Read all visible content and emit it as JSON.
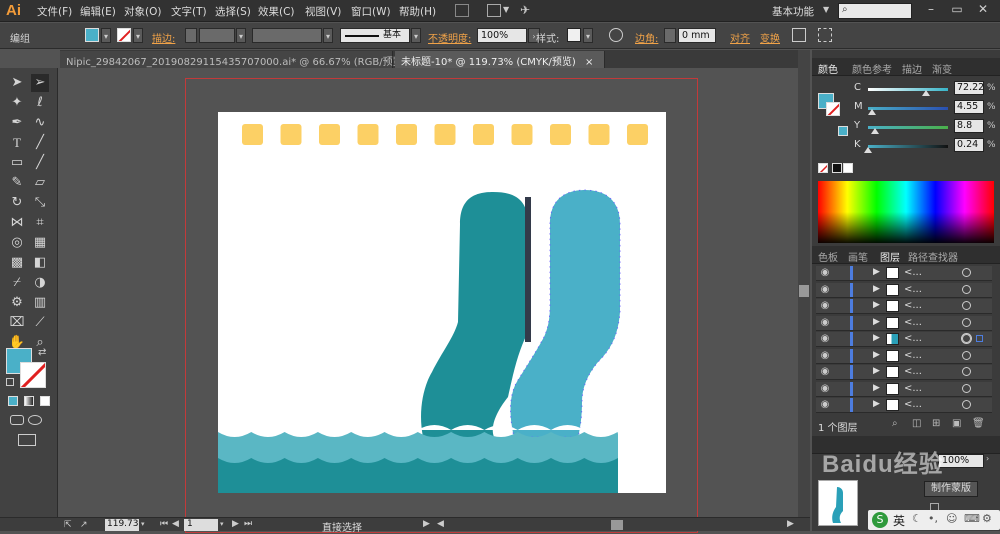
{
  "app": {
    "logo": "Ai",
    "workspace": "基本功能"
  },
  "menu": [
    "文件(F)",
    "编辑(E)",
    "对象(O)",
    "文字(T)",
    "选择(S)",
    "效果(C)",
    "视图(V)",
    "窗口(W)",
    "帮助(H)"
  ],
  "control_bar": {
    "selection_label": "编组",
    "stroke_label": "描边:",
    "stroke_style": "基本",
    "opacity_label": "不透明度:",
    "opacity_value": "100%",
    "style_label": "样式:",
    "corner_label": "边角:",
    "corner_value": "0 mm",
    "align_label": "对齐",
    "transform_label": "变换"
  },
  "tabs": [
    {
      "label": "Nipic_29842067_20190829115435707000.ai* @ 66.67% (RGB/预览)",
      "active": false
    },
    {
      "label": "未标题-10* @ 119.73% (CMYK/预览)",
      "active": true
    }
  ],
  "status_bar": {
    "zoom": "119.73",
    "page": "1",
    "tool": "直接选择"
  },
  "color_panel": {
    "tabs": [
      "颜色",
      "颜色参考",
      "描边",
      "渐变"
    ],
    "sliders": [
      {
        "channel": "C",
        "value": "72.22",
        "fraction": 0.72,
        "color": "#38b4c8"
      },
      {
        "channel": "M",
        "value": "4.55",
        "fraction": 0.05,
        "color": "#d34a9a"
      },
      {
        "channel": "Y",
        "value": "8.8",
        "fraction": 0.09,
        "color": "#d7d24c"
      },
      {
        "channel": "K",
        "value": "0.24",
        "fraction": 0.0,
        "color": "#222222"
      }
    ],
    "pct": "%",
    "fill_color": "#4ab0c8"
  },
  "layers_panel": {
    "tabs": [
      "色板",
      "画笔",
      "图层",
      "路径查找器"
    ],
    "rows": [
      {
        "name": "<...",
        "selected": false
      },
      {
        "name": "<...",
        "selected": false
      },
      {
        "name": "<...",
        "selected": false
      },
      {
        "name": "<...",
        "selected": false
      },
      {
        "name": "<...",
        "selected": true
      },
      {
        "name": "<...",
        "selected": false
      },
      {
        "name": "<...",
        "selected": false
      },
      {
        "name": "<...",
        "selected": false
      },
      {
        "name": "<...",
        "selected": false
      }
    ],
    "footer": "1 个图层"
  },
  "bottom_panel": {
    "opacity_value": "100%",
    "make_mask": "制作蒙版"
  },
  "artwork": {
    "square_color": "#fcd065",
    "dark_teal": "#1e8f97",
    "light_teal": "#4ab0c8",
    "wave_color": "#5ab7c4"
  },
  "taskbar": {
    "ime": "英"
  },
  "watermark": "Baidu经验"
}
